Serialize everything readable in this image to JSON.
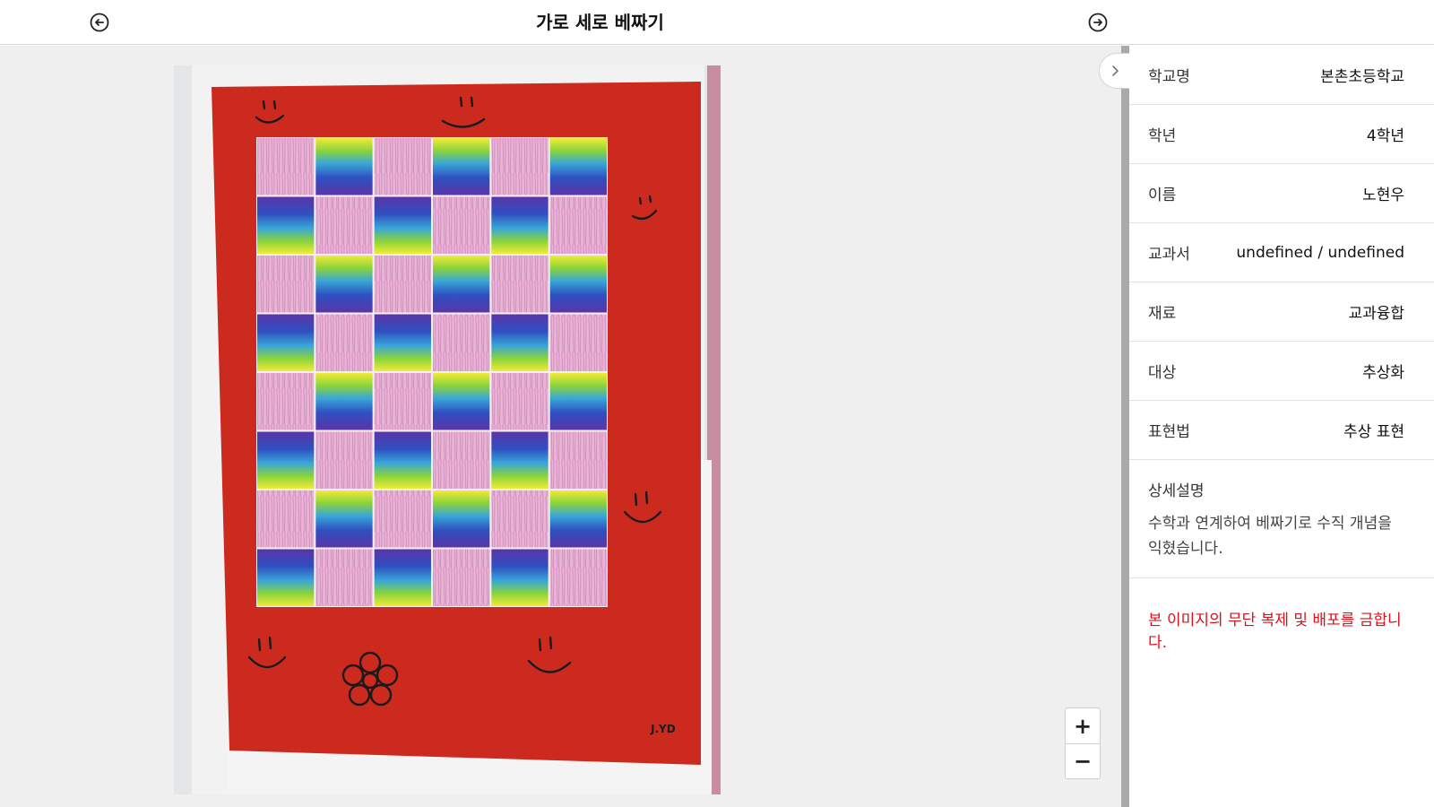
{
  "header": {
    "title": "가로 세로 베짜기",
    "prev_icon": "arrow-left-circle-icon",
    "next_icon": "arrow-right-circle-icon"
  },
  "artwork": {
    "description": "",
    "signature": "J.YD"
  },
  "zoom": {
    "in_label": "+",
    "out_label": "−"
  },
  "panel": {
    "toggle_icon": "chevron-right-icon",
    "rows": [
      {
        "label": "학교명",
        "value": "본촌초등학교"
      },
      {
        "label": "학년",
        "value": "4학년"
      },
      {
        "label": "이름",
        "value": "노현우"
      },
      {
        "label": "교과서",
        "value": "undefined / undefined"
      },
      {
        "label": "재료",
        "value": "교과융합"
      },
      {
        "label": "대상",
        "value": "추상화"
      },
      {
        "label": "표현법",
        "value": "추상 표현"
      }
    ],
    "description_label": "상세설명",
    "description_text": "수학과 연계하여 베짜기로 수직 개념을 익혔습니다.",
    "notice": "본 이미지의 무단 복제 및 배포를 금합니다."
  },
  "colors": {
    "paper_red": "#cc2a1f",
    "notice_red": "#e0101a",
    "strip_pink": "#e7a9d2",
    "rainbow": [
      "#f2ea38",
      "#7ad23c",
      "#2e86d6",
      "#3549b8",
      "#5a35a8"
    ]
  }
}
